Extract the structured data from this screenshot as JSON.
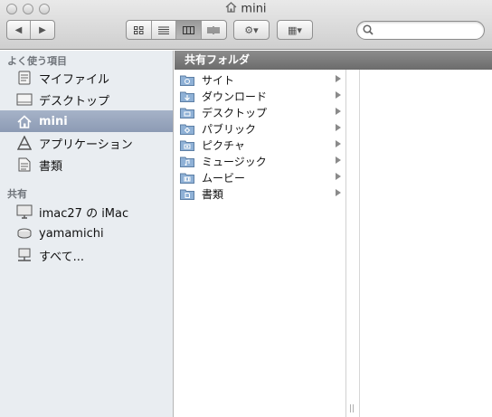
{
  "window": {
    "title": "mini"
  },
  "toolbar": {
    "back_label": "◀",
    "forward_label": "▶",
    "action_label": "⚙▾",
    "arrange_label": "▦▾",
    "search_placeholder": ""
  },
  "sidebar": {
    "favorites_header": "よく使う項目",
    "favorites": [
      {
        "label": "マイファイル",
        "icon": "all-my-files-icon"
      },
      {
        "label": "デスクトップ",
        "icon": "desktop-icon"
      },
      {
        "label": "mini",
        "icon": "home-icon",
        "selected": true
      },
      {
        "label": "アプリケーション",
        "icon": "applications-icon"
      },
      {
        "label": "書類",
        "icon": "documents-icon"
      }
    ],
    "shared_header": "共有",
    "shared": [
      {
        "label": "imac27 の iMac",
        "icon": "computer-icon"
      },
      {
        "label": "yamamichi",
        "icon": "network-disk-icon"
      },
      {
        "label": "すべて...",
        "icon": "network-icon"
      }
    ]
  },
  "browser": {
    "column_header": "共有フォルダ",
    "items": [
      {
        "label": "サイト",
        "icon": "sites-folder-icon"
      },
      {
        "label": "ダウンロード",
        "icon": "downloads-folder-icon"
      },
      {
        "label": "デスクトップ",
        "icon": "desktop-folder-icon"
      },
      {
        "label": "パブリック",
        "icon": "public-folder-icon"
      },
      {
        "label": "ピクチャ",
        "icon": "pictures-folder-icon"
      },
      {
        "label": "ミュージック",
        "icon": "music-folder-icon"
      },
      {
        "label": "ムービー",
        "icon": "movies-folder-icon"
      },
      {
        "label": "書類",
        "icon": "documents-folder-icon"
      }
    ],
    "resize_handle": "||"
  },
  "colors": {
    "selection": "#9aa8bf",
    "sidebar_bg": "#e9edf1",
    "folder": "#7fa3c9"
  }
}
